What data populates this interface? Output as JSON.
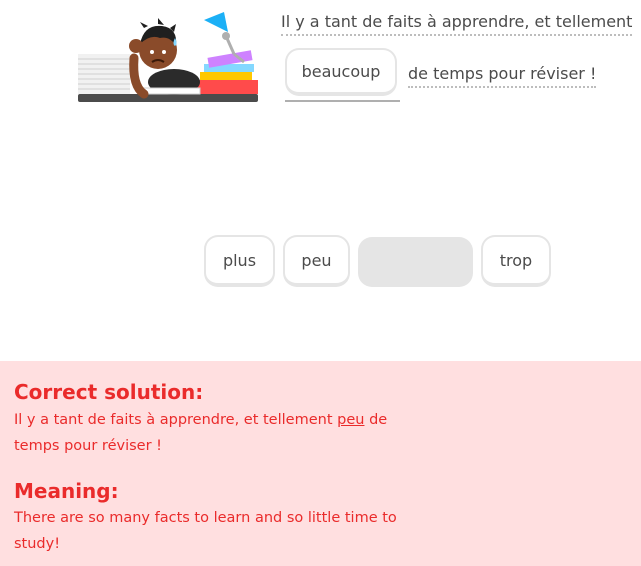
{
  "exercise": {
    "sentence_part1": "Il y a tant de faits à apprendre, et tellement",
    "sentence_part2": "de temps pour réviser !",
    "selected_answer": "beaucoup"
  },
  "word_bank": {
    "words": [
      "plus",
      "peu",
      "trop"
    ]
  },
  "feedback": {
    "solution_heading": "Correct solution:",
    "solution_before": "Il y a tant de faits à apprendre, et tellement",
    "solution_highlight": "peu",
    "solution_after": "de temps pour réviser !",
    "meaning_heading": "Meaning:",
    "meaning_text": "There are so many facts to learn and so little time to study!"
  },
  "colors": {
    "error_text": "#ea2b2b",
    "error_background": "#ffdfe0",
    "chip_border": "#e5e5e5",
    "body_text": "#4b4b4b"
  }
}
